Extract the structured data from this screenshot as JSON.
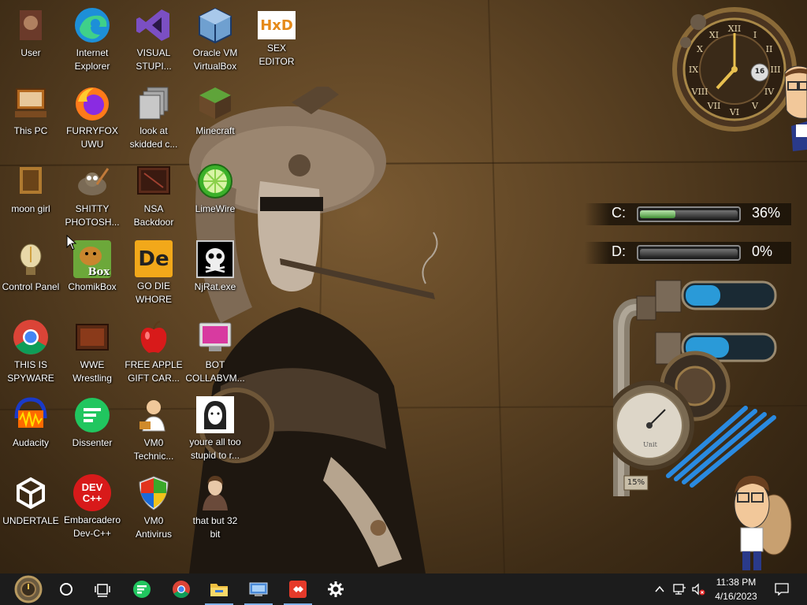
{
  "desktop": {
    "icons": [
      {
        "label": "User",
        "icon": "user-folder-icon"
      },
      {
        "label": "Internet\nExplorer",
        "icon": "edge-icon"
      },
      {
        "label": "VISUAL\nSTUPI...",
        "icon": "visual-studio-icon"
      },
      {
        "label": "Oracle VM\nVirtualBox",
        "icon": "virtualbox-icon"
      },
      {
        "label": "SEX\nEDITOR",
        "icon": "hxd-icon",
        "glyph_text": "HxD"
      },
      {
        "label": "This PC",
        "icon": "computer-icon"
      },
      {
        "label": "FURRYFOX\nUWU",
        "icon": "firefox-icon"
      },
      {
        "label": "look at\nskidded c...",
        "icon": "copy-pages-icon"
      },
      {
        "label": "Minecraft",
        "icon": "minecraft-icon"
      },
      {
        "label": "moon girl",
        "icon": "moon-girl-icon"
      },
      {
        "label": "SHITTY\nPHOTOSH...",
        "icon": "gimp-icon"
      },
      {
        "label": "NSA\nBackdoor",
        "icon": "nsa-backdoor-icon"
      },
      {
        "label": "LimeWire",
        "icon": "limewire-icon"
      },
      {
        "label": "Control Panel",
        "icon": "control-panel-icon"
      },
      {
        "label": "ChomikBox",
        "icon": "chomikbox-icon",
        "glyph_text": "Box"
      },
      {
        "label": "GO DIE\nWHORE",
        "icon": "godie-icon",
        "glyph_text": "De"
      },
      {
        "label": "NjRat.exe",
        "icon": "skull-icon"
      },
      {
        "label": "THIS IS\nSPYWARE",
        "icon": "chrome-icon"
      },
      {
        "label": "WWE\nWrestling",
        "icon": "wwe-icon"
      },
      {
        "label": "FREE APPLE\nGIFT CAR...",
        "icon": "apple-icon"
      },
      {
        "label": "BOT\nCOLLABVM...",
        "icon": "monitor-icon"
      },
      {
        "label": "Audacity",
        "icon": "audacity-icon"
      },
      {
        "label": "Dissenter",
        "icon": "dissenter-icon"
      },
      {
        "label": "VM0\nTechnic...",
        "icon": "technician-icon"
      },
      {
        "label": "youre all too\nstupid to r...",
        "icon": "portrait-sketch-icon"
      },
      {
        "label": "UNDERTALE",
        "icon": "unity-icon"
      },
      {
        "label": "Embarcadero\nDev-C++",
        "icon": "devcpp-icon",
        "glyph_text": "DEV\nC++"
      },
      {
        "label": "VM0\nAntivirus",
        "icon": "shield-icon"
      },
      {
        "label": "that but 32\nbit",
        "icon": "portrait-painting-icon"
      }
    ]
  },
  "widgets": {
    "clock": {
      "date_number": "16",
      "icon": "steampunk-clock-icon"
    },
    "drives": [
      {
        "label": "C:",
        "percent_text": "36%",
        "usage": 36
      },
      {
        "label": "D:",
        "percent_text": "0%",
        "usage": 0
      }
    ],
    "pipes": {
      "gauge_percent_text": "15%",
      "gauge_face_text": "Unit",
      "tank_levels": [
        40,
        50
      ]
    }
  },
  "taskbar": {
    "items": [
      {
        "icon": "steampunk-start-icon"
      },
      {
        "icon": "cortana-circle-icon"
      },
      {
        "icon": "task-view-icon"
      },
      {
        "icon": "dissenter-icon"
      },
      {
        "icon": "chrome-icon"
      },
      {
        "icon": "file-explorer-icon"
      },
      {
        "icon": "control-panel-icon"
      },
      {
        "icon": "anydesk-icon"
      },
      {
        "icon": "settings-gear-icon"
      }
    ],
    "tray": {
      "time": "11:38 PM",
      "date": "4/16/2023"
    }
  }
}
